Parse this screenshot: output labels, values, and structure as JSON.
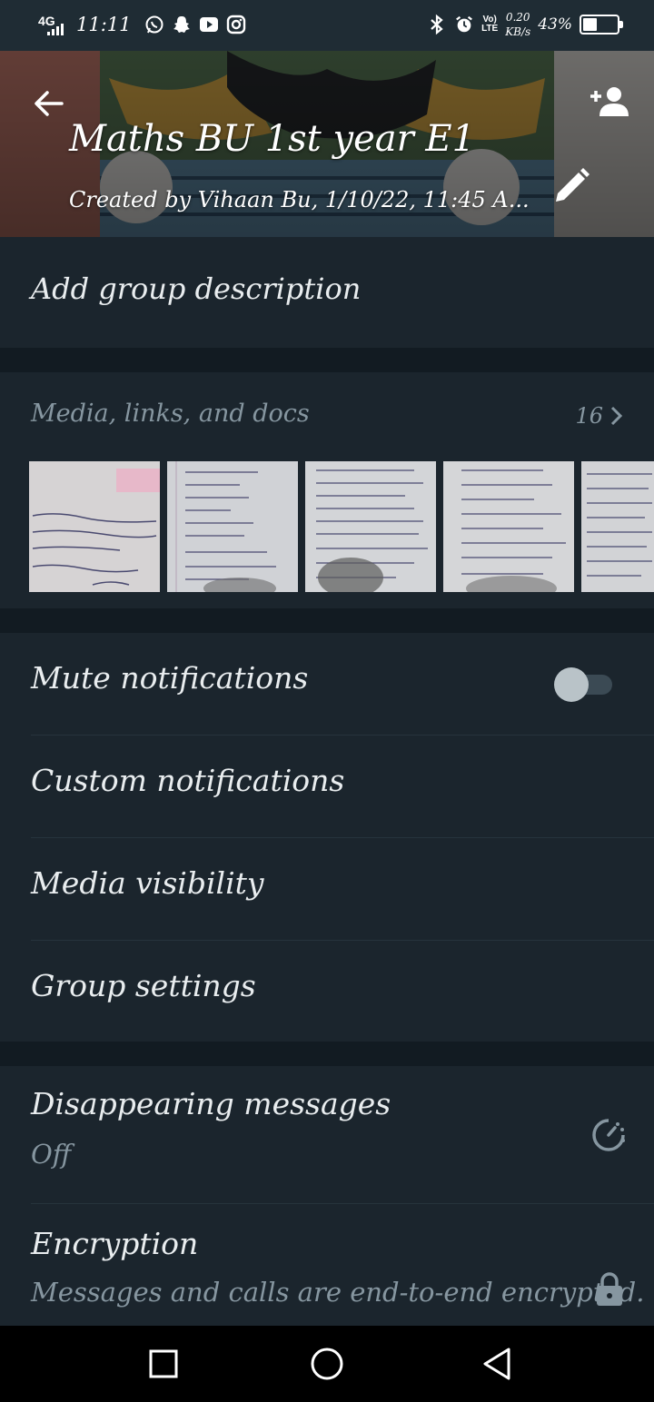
{
  "status_bar": {
    "network": "4G",
    "time": "11:11",
    "volte_line1": "Vo)",
    "volte_line2": "LTE",
    "speed_value": "0.20",
    "speed_unit": "KB/s",
    "battery_percent": "43%",
    "battery_level": 0.43,
    "left_icons": [
      "whatsapp-icon",
      "snapchat-icon",
      "youtube-icon",
      "instagram-icon"
    ],
    "right_icons": [
      "bluetooth-icon",
      "alarm-icon"
    ]
  },
  "header": {
    "title": "Maths BU 1st year E1",
    "subtitle": "Created by Vihaan Bu, 1/10/22, 11:45 A...",
    "icons": [
      "back-arrow-icon",
      "add-person-icon",
      "edit-pencil-icon"
    ]
  },
  "description": {
    "label": "Add group description"
  },
  "media": {
    "label": "Media, links, and docs",
    "count": "16",
    "thumbnail_count": 5
  },
  "settings": {
    "mute": "Mute notifications",
    "mute_enabled": false,
    "custom": "Custom notifications",
    "media_visibility": "Media visibility",
    "group_settings": "Group settings"
  },
  "privacy": {
    "disappearing_label": "Disappearing messages",
    "disappearing_value": "Off",
    "encryption_label": "Encryption",
    "encryption_desc": "Messages and calls are end-to-end encrypted."
  },
  "colors": {
    "background": "#121b22",
    "section": "#1b252d",
    "secondary_text": "#8696a0",
    "primary_text": "#e9edef"
  }
}
